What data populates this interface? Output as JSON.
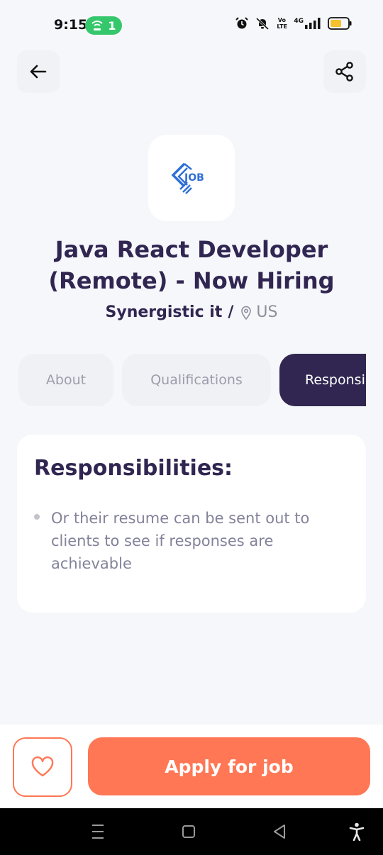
{
  "status_bar": {
    "time": "9:15",
    "hotspot_count": "1",
    "icons": [
      "wifi-hotspot-icon",
      "alarm-icon",
      "mute-icon",
      "volte-icon",
      "4g-signal-icon",
      "battery-icon"
    ],
    "network": "4G",
    "volte": "Vo LTE"
  },
  "header": {
    "back_icon": "arrow-left-icon",
    "share_icon": "share-icon"
  },
  "job": {
    "logo_text": "JOB",
    "title": "Java React Developer (Remote) - Now Hiring",
    "company": "Synergistic it",
    "separator": "/",
    "location": "US"
  },
  "tabs": [
    {
      "label": "About",
      "active": false
    },
    {
      "label": "Qualifications",
      "active": false
    },
    {
      "label": "Responsibilities",
      "active": true
    }
  ],
  "responsibilities": {
    "heading": "Responsibilities:",
    "items": [
      "Or their resume can be sent out to clients to see if responses are achievable"
    ]
  },
  "footer": {
    "favorite_icon": "heart-icon",
    "apply_label": "Apply for job"
  },
  "nav": {
    "icons": [
      "recent-apps-icon",
      "home-icon",
      "back-icon",
      "accessibility-icon"
    ]
  },
  "colors": {
    "primary": "#312651",
    "accent": "#ff7754",
    "background": "#f6f7fb",
    "muted": "#83829a",
    "logo_blue": "#2f6fd6"
  }
}
